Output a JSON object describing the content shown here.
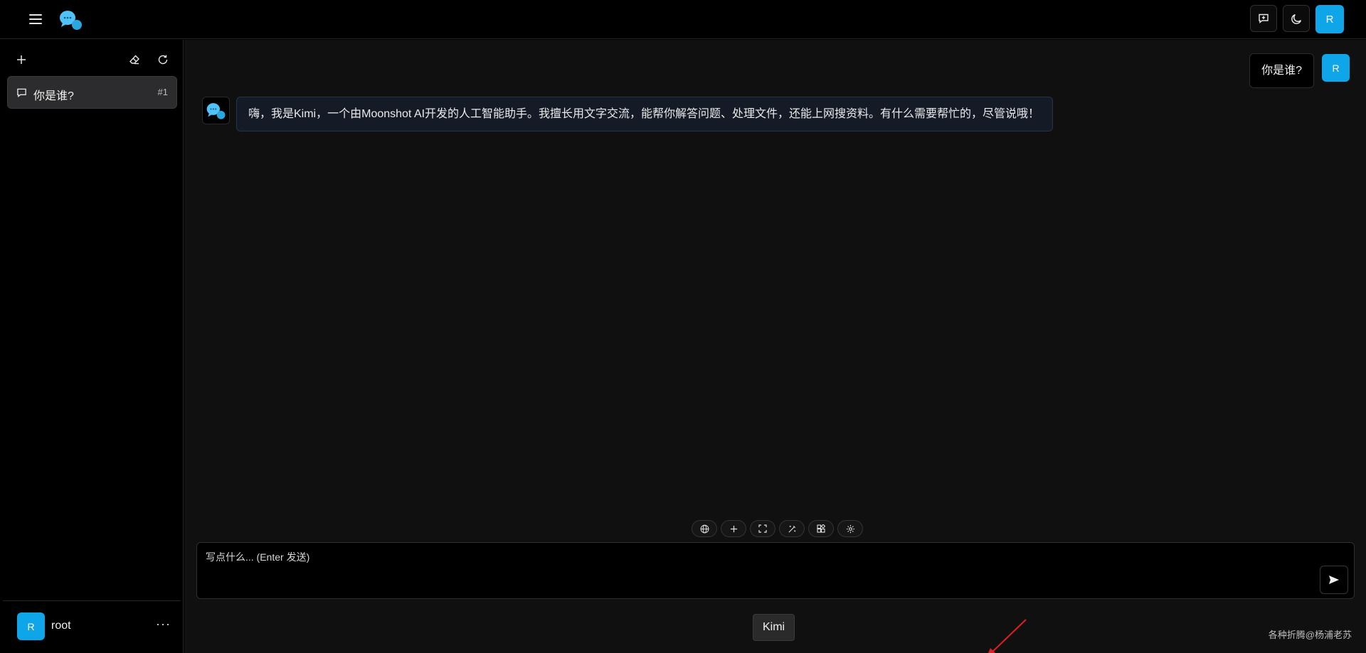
{
  "header": {
    "menu_icon": "hamburger-menu-icon",
    "logo_icon": "chat-bubbles-logo-icon",
    "actions": {
      "new_chat_icon": "message-plus-icon",
      "theme_icon": "moon-icon",
      "avatar_letter": "R"
    }
  },
  "sidebar": {
    "tools": [
      "plus-icon",
      "eraser-icon",
      "refresh-icon"
    ],
    "conversations": [
      {
        "title": "你是谁?",
        "badge": "#1",
        "icon": "message-square-icon"
      }
    ],
    "user": {
      "avatar_letter": "R",
      "name": "root",
      "more": "···"
    }
  },
  "chat": {
    "messages": [
      {
        "role": "user",
        "text": "你是谁?",
        "avatar_letter": "R"
      },
      {
        "role": "assistant",
        "text": "嗨，我是Kimi，一个由Moonshot AI开发的人工智能助手。我擅长用文字交流，能帮你解答问题、处理文件，还能上网搜资料。有什么需要帮忙的，尽管说哦！"
      }
    ]
  },
  "composer": {
    "toolbar": [
      "globe-icon",
      "plus-icon",
      "fullscreen-icon",
      "magic-wand-icon",
      "apps-icon",
      "settings-icon"
    ],
    "placeholder": "写点什么... (Enter 发送)",
    "send_icon": "send-icon",
    "model_label": "Kimi"
  },
  "watermark": "各种折腾@杨浦老苏",
  "colors": {
    "accent": "#0ea5e9",
    "background": "#101010",
    "sidebar": "#000000",
    "assistant_bubble": "#141b26",
    "annotation_arrow": "#e02020"
  }
}
